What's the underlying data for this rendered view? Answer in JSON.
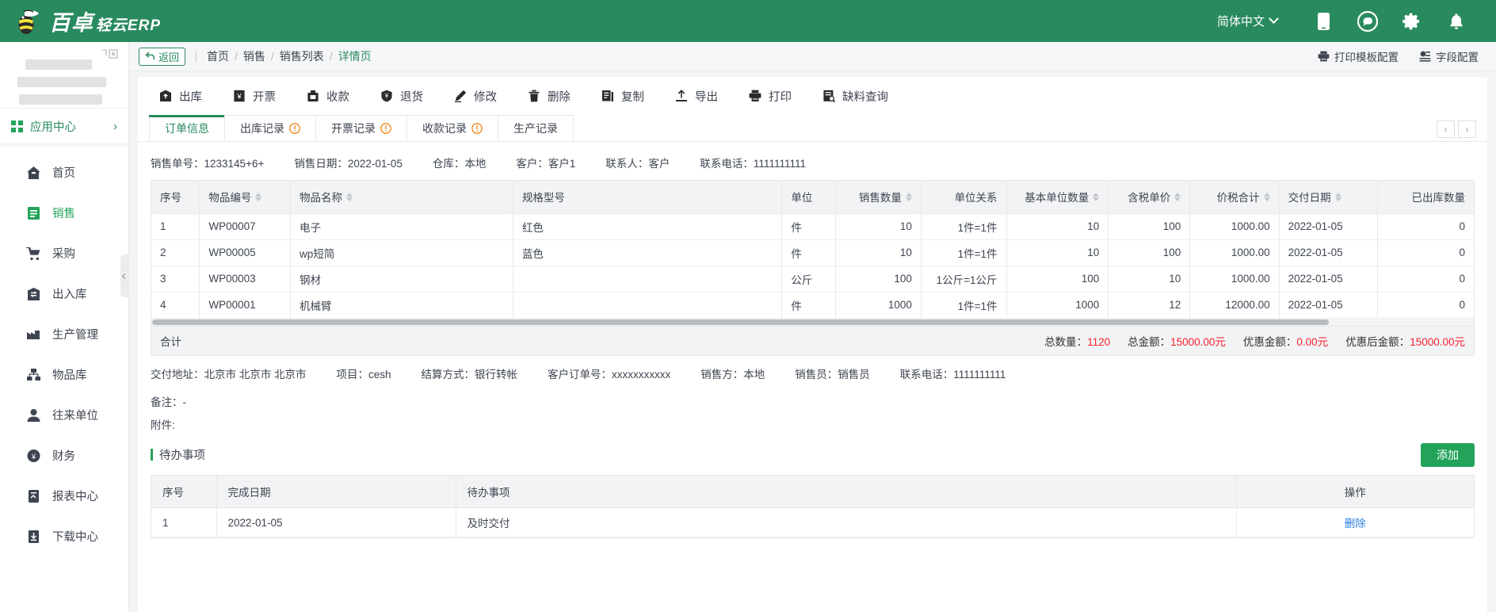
{
  "header": {
    "brand_main": "百卓",
    "brand_sub": "轻云ERP",
    "language": "简体中文",
    "icons": [
      "mobile-icon",
      "chat-icon",
      "gear-icon",
      "bell-icon"
    ]
  },
  "breadcrumb": {
    "back_label": "返回",
    "items": [
      "首页",
      "销售",
      "销售列表",
      "详情页"
    ],
    "separator": "/",
    "actions": [
      {
        "label": "打印模板配置",
        "icon": "printer-icon"
      },
      {
        "label": "字段配置",
        "icon": "settings-sliders-icon"
      }
    ]
  },
  "sidebar": {
    "app_center": "应用中心",
    "items": [
      {
        "label": "首页",
        "icon": "home-icon",
        "active": false
      },
      {
        "label": "销售",
        "icon": "sales-icon",
        "active": true
      },
      {
        "label": "采购",
        "icon": "cart-icon",
        "active": false
      },
      {
        "label": "出入库",
        "icon": "warehouse-icon",
        "active": false
      },
      {
        "label": "生产管理",
        "icon": "production-icon",
        "active": false
      },
      {
        "label": "物品库",
        "icon": "items-icon",
        "active": false
      },
      {
        "label": "往来单位",
        "icon": "contacts-icon",
        "active": false
      },
      {
        "label": "财务",
        "icon": "finance-icon",
        "active": false
      },
      {
        "label": "报表中心",
        "icon": "report-icon",
        "active": false
      },
      {
        "label": "下载中心",
        "icon": "download-icon",
        "active": false
      }
    ]
  },
  "toolbar": {
    "items": [
      {
        "label": "出库",
        "icon": "outbound-icon"
      },
      {
        "label": "开票",
        "icon": "invoice-icon"
      },
      {
        "label": "收款",
        "icon": "receive-payment-icon"
      },
      {
        "label": "退货",
        "icon": "return-goods-icon"
      },
      {
        "label": "修改",
        "icon": "edit-icon"
      },
      {
        "label": "删除",
        "icon": "trash-icon"
      },
      {
        "label": "复制",
        "icon": "copy-icon"
      },
      {
        "label": "导出",
        "icon": "export-icon"
      },
      {
        "label": "打印",
        "icon": "print-icon"
      },
      {
        "label": "缺料查询",
        "icon": "shortage-query-icon"
      }
    ]
  },
  "tabs": [
    {
      "label": "订单信息",
      "warn": false,
      "active": true
    },
    {
      "label": "出库记录",
      "warn": true,
      "active": false
    },
    {
      "label": "开票记录",
      "warn": true,
      "active": false
    },
    {
      "label": "收款记录",
      "warn": true,
      "active": false
    },
    {
      "label": "生产记录",
      "warn": false,
      "active": false
    }
  ],
  "order_info": [
    {
      "label": "销售单号：",
      "value": "1233145+6+"
    },
    {
      "label": "销售日期：",
      "value": "2022-01-05"
    },
    {
      "label": "仓库：",
      "value": "本地"
    },
    {
      "label": "客户：",
      "value": "客户1"
    },
    {
      "label": "联系人：",
      "value": "客户"
    },
    {
      "label": "联系电话：",
      "value": "1111111111"
    }
  ],
  "table": {
    "columns": [
      {
        "label": "序号",
        "sortable": false,
        "align": "left"
      },
      {
        "label": "物品编号",
        "sortable": true,
        "align": "left"
      },
      {
        "label": "物品名称",
        "sortable": true,
        "align": "left"
      },
      {
        "label": "规格型号",
        "sortable": false,
        "align": "left"
      },
      {
        "label": "单位",
        "sortable": false,
        "align": "left"
      },
      {
        "label": "销售数量",
        "sortable": true,
        "align": "right"
      },
      {
        "label": "单位关系",
        "sortable": false,
        "align": "right"
      },
      {
        "label": "基本单位数量",
        "sortable": true,
        "align": "right"
      },
      {
        "label": "含税单价",
        "sortable": true,
        "align": "right"
      },
      {
        "label": "价税合计",
        "sortable": true,
        "align": "right"
      },
      {
        "label": "交付日期",
        "sortable": true,
        "align": "left"
      },
      {
        "label": "已出库数量",
        "sortable": false,
        "align": "right"
      }
    ],
    "rows": [
      [
        "1",
        "WP00007",
        "电子",
        "红色",
        "件",
        "10",
        "1件=1件",
        "10",
        "100",
        "1000.00",
        "2022-01-05",
        "0"
      ],
      [
        "2",
        "WP00005",
        "wp短简",
        "蓝色",
        "件",
        "10",
        "1件=1件",
        "10",
        "100",
        "1000.00",
        "2022-01-05",
        "0"
      ],
      [
        "3",
        "WP00003",
        "钢材",
        "",
        "公斤",
        "100",
        "1公斤=1公斤",
        "100",
        "10",
        "1000.00",
        "2022-01-05",
        "0"
      ],
      [
        "4",
        "WP00001",
        "机械臂",
        "",
        "件",
        "1000",
        "1件=1件",
        "1000",
        "12",
        "12000.00",
        "2022-01-05",
        "0"
      ]
    ]
  },
  "totals": {
    "label": "合计",
    "entries": [
      {
        "label": "总数量：",
        "value": "1120"
      },
      {
        "label": "总金额：",
        "value": "15000.00元"
      },
      {
        "label": "优惠金额：",
        "value": "0.00元"
      },
      {
        "label": "优惠后金额：",
        "value": "15000.00元"
      }
    ]
  },
  "detail_info": [
    {
      "label": "交付地址：",
      "value": "北京市 北京市 北京市"
    },
    {
      "label": "项目：",
      "value": "cesh"
    },
    {
      "label": "结算方式：",
      "value": "银行转帐"
    },
    {
      "label": "客户订单号：",
      "value": "xxxxxxxxxxx"
    },
    {
      "label": "销售方：",
      "value": "本地"
    },
    {
      "label": "销售员：",
      "value": "销售员"
    },
    {
      "label": "联系电话：",
      "value": "1111111111"
    }
  ],
  "remark": {
    "label": "备注：",
    "value": "-"
  },
  "attachment": {
    "label": "附件:",
    "value": ""
  },
  "todo": {
    "title": "待办事项",
    "add_label": "添加",
    "columns": [
      "序号",
      "完成日期",
      "待办事项",
      "操作"
    ],
    "rows": [
      {
        "index": "1",
        "date": "2022-01-05",
        "task": "及时交付",
        "action": "删除"
      }
    ]
  },
  "colors": {
    "brand_green": "#2a8a5f",
    "accent_green": "#23a35a",
    "amount_red": "#f5222d",
    "warn_orange": "#f0861a",
    "link_blue": "#2f7fe0"
  }
}
